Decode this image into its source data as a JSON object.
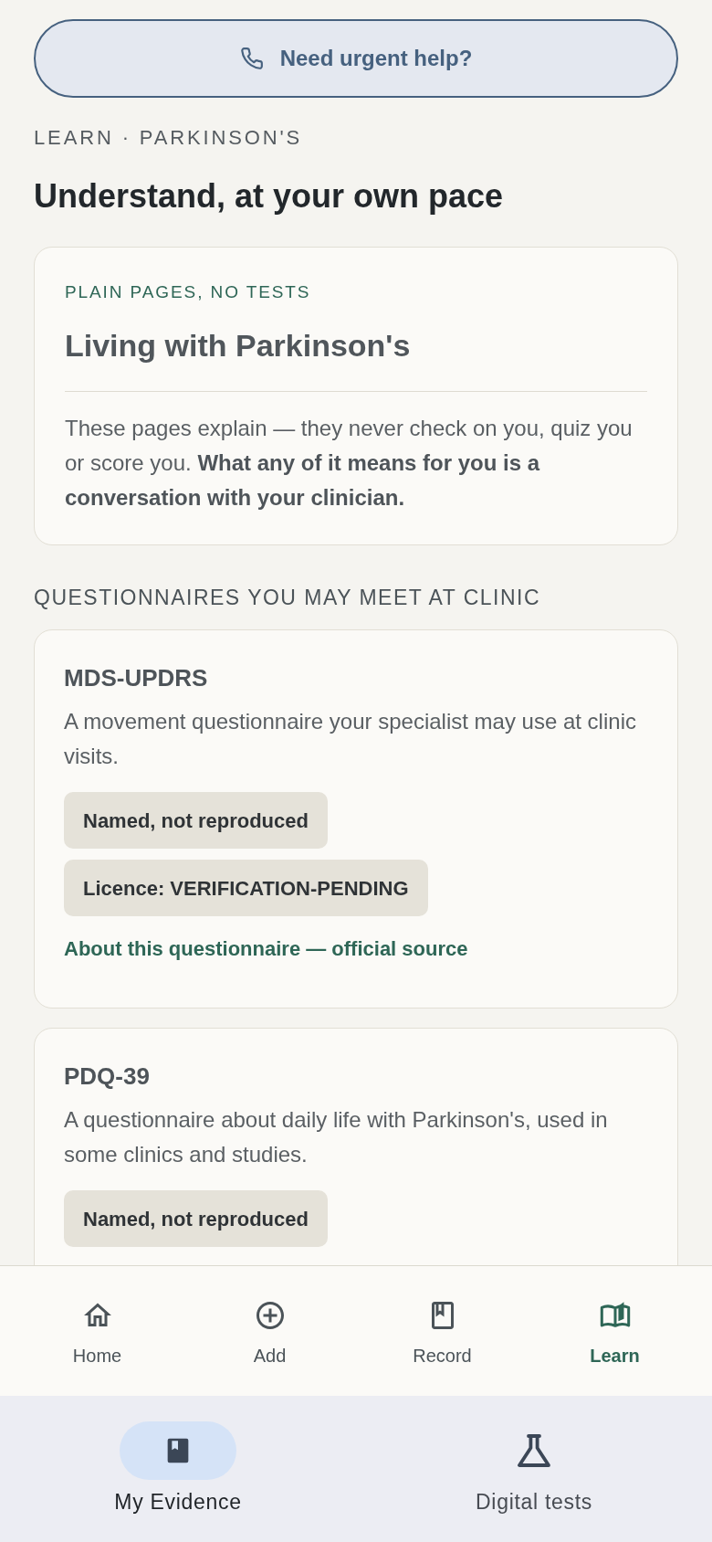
{
  "urgent_button": {
    "label": "Need urgent help?"
  },
  "breadcrumb": "LEARN · PARKINSON'S",
  "heading": "Understand, at your own pace",
  "intro_card": {
    "eyebrow": "PLAIN PAGES, NO TESTS",
    "title": "Living with Parkinson's",
    "body": "These pages explain — they never check on you, quiz you or score you. **What any of it means for you is a conversation with your clinician.**"
  },
  "section_title": "QUESTIONNAIRES YOU MAY MEET AT CLINIC",
  "questionnaires": [
    {
      "name": "MDS-UPDRS",
      "description": "A movement questionnaire your specialist may use at clinic visits.",
      "tags": [
        "Named, not reproduced",
        "Licence: VERIFICATION-PENDING"
      ],
      "link": "About this questionnaire — official source"
    },
    {
      "name": "PDQ-39",
      "description": "A questionnaire about daily life with Parkinson's, used in some clinics and studies.",
      "tags": [
        "Named, not reproduced"
      ]
    }
  ],
  "tab_bar": [
    {
      "label": "Home",
      "selected": false
    },
    {
      "label": "Add",
      "selected": false
    },
    {
      "label": "Record",
      "selected": false
    },
    {
      "label": "Learn",
      "selected": true
    }
  ],
  "bottom_nav": [
    {
      "label": "My Evidence",
      "selected": true
    },
    {
      "label": "Digital tests",
      "selected": false
    }
  ]
}
